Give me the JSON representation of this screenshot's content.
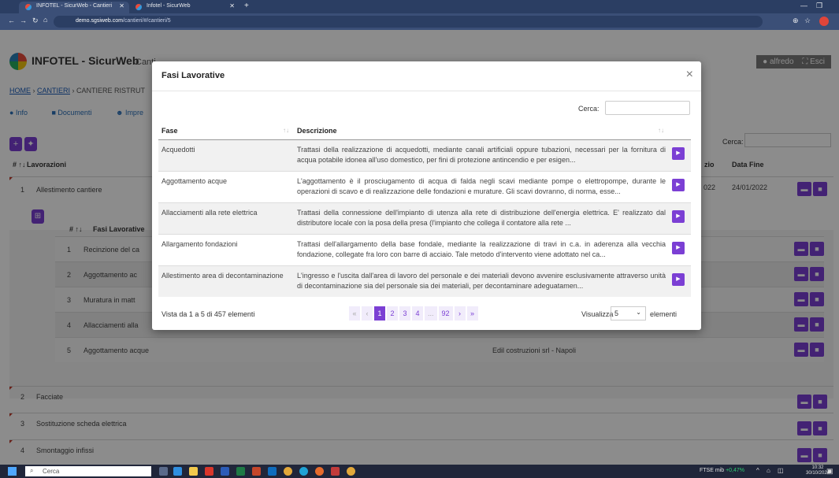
{
  "browser": {
    "tabs": [
      {
        "title": "INFOTEL - SicurWeb - Cantieri",
        "active": true
      },
      {
        "title": "Infotel - SicurWeb",
        "active": false
      }
    ],
    "new_tab": "+",
    "url_host": "demo.sgsiweb.com",
    "url_path": "/cantieri/#/cantieri/5"
  },
  "app": {
    "brand": "INFOTEL - SicurWeb",
    "brand_section": "Canti",
    "user": "alfredo",
    "exit": "Esci",
    "breadcrumb": {
      "home": "HOME",
      "sep1": " › ",
      "cantieri": "CANTIERI",
      "sep2": " › ",
      "current": "CANTIERE RISTRUT"
    },
    "subnav": {
      "info": "Info",
      "documenti": "Documenti",
      "imprese": "Impre"
    },
    "bg_search_label": "Cerca:",
    "lavorazioni_header": {
      "num": "# ↑↓",
      "name": "Lavorazioni",
      "inizio": "zio",
      "fine": "Data Fine"
    },
    "lavorazioni": [
      {
        "num": "1",
        "name": "Allestimento cantiere",
        "inizio": "022",
        "fine": "24/01/2022"
      },
      {
        "num": "2",
        "name": "Facciate"
      },
      {
        "num": "3",
        "name": "Sostituzione scheda elettrica"
      },
      {
        "num": "4",
        "name": "Smontaggio infissi"
      }
    ],
    "fasi_header": {
      "num": "# ↑↓",
      "name": "Fasi Lavorative"
    },
    "fasi_rows": [
      {
        "num": "1",
        "name": "Recinzione del ca"
      },
      {
        "num": "2",
        "name": "Aggottamento ac"
      },
      {
        "num": "3",
        "name": "Muratura in matt"
      },
      {
        "num": "4",
        "name": "Allacciamenti alla"
      },
      {
        "num": "5",
        "name": "Aggottamento acque",
        "impresa": "Edil costruzioni srl - Napoli"
      }
    ]
  },
  "modal": {
    "title": "Fasi Lavorative",
    "close": "×",
    "search_label": "Cerca:",
    "search_value": "",
    "columns": {
      "fase": "Fase",
      "descrizione": "Descrizione",
      "sort": "↑↓"
    },
    "rows": [
      {
        "fase": "Acquedotti",
        "descrizione": "Trattasi della realizzazione di acquedotti, mediante canali artificiali oppure tubazioni, necessari per la fornitura di acqua potabile idonea all'uso domestico, per fini di protezione antincendio e per esigen..."
      },
      {
        "fase": "Aggottamento acque",
        "descrizione": "L'aggottamento è il prosciugamento di acqua di falda negli scavi mediante pompe o elettropompe, durante le operazioni di scavo e di realizzazione delle fondazioni e murature. Gli scavi dovranno, di norma, esse..."
      },
      {
        "fase": "Allacciamenti alla rete elettrica",
        "descrizione": "Trattasi della connessione dell'impianto di utenza alla rete di distribuzione dell'energia elettrica. E' realizzato dal distributore locale con la posa della presa (l'impianto che collega il contatore alla rete ..."
      },
      {
        "fase": "Allargamento fondazioni",
        "descrizione": "Trattasi dell'allargamento della base fondale, mediante la realizzazione di travi in c.a. in aderenza alla vecchia fondazione, collegate fra loro con barre di acciaio. Tale metodo d'intervento viene adottato nel ca..."
      },
      {
        "fase": "Allestimento area di decontaminazione",
        "descrizione": "L'ingresso e l'uscita dall'area di lavoro del personale e dei materiali devono avvenire esclusivamente attraverso unità di decontaminazione sia del personale sia dei materiali, per decontaminare adeguatamen..."
      }
    ],
    "info": "Vista da 1 a 5 di 457 elementi",
    "pager": [
      "«",
      "‹",
      "1",
      "2",
      "3",
      "4",
      "...",
      "92",
      "›",
      "»"
    ],
    "active_page": "1",
    "page_size_label": "Visualizza",
    "page_size": "5",
    "page_size_suffix": "elementi"
  },
  "taskbar": {
    "search": "Cerca",
    "ticker_name": "FTSE mib",
    "ticker_change": "+0,47%",
    "time": "10:32",
    "date": "30/10/2024"
  },
  "colors": {
    "accent": "#7b3fd4",
    "link": "#1a5bb8",
    "chrome": "#2b3e63"
  }
}
